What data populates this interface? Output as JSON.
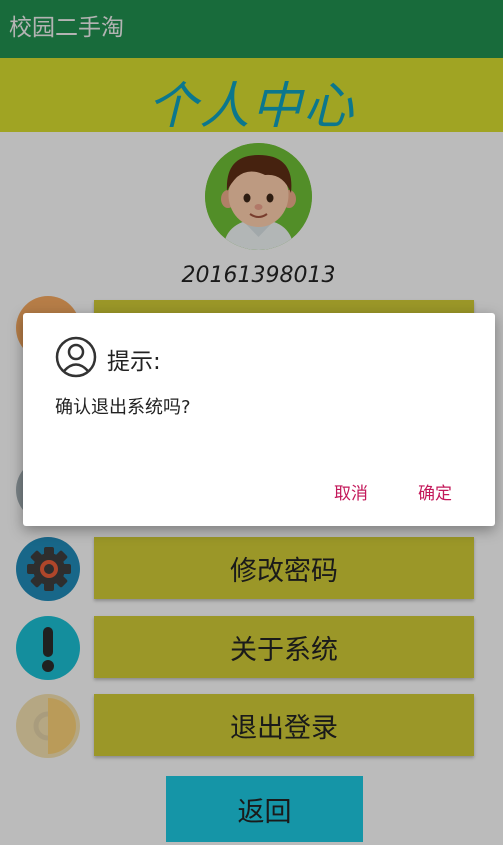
{
  "app": {
    "title": "校园二手淘"
  },
  "header": {
    "title": "个人中心"
  },
  "profile": {
    "user_id": "20161398013"
  },
  "menu": {
    "items": [
      {
        "label": "修改密码",
        "icon": "gear-icon"
      },
      {
        "label": "关于系统",
        "icon": "exclamation-icon"
      },
      {
        "label": "退出登录",
        "icon": "logout-icon"
      }
    ]
  },
  "back_button": {
    "label": "返回"
  },
  "dialog": {
    "title": "提示:",
    "message": "确认退出系统吗?",
    "cancel_label": "取消",
    "confirm_label": "确定",
    "icon": "user-icon"
  },
  "colors": {
    "appbar": "#1f8a4c",
    "banner": "#cdd32e",
    "banner_text": "#0f99b5",
    "menu_button": "#c7c234",
    "back_button": "#1cbfd6",
    "dialog_action": "#c3185a"
  }
}
